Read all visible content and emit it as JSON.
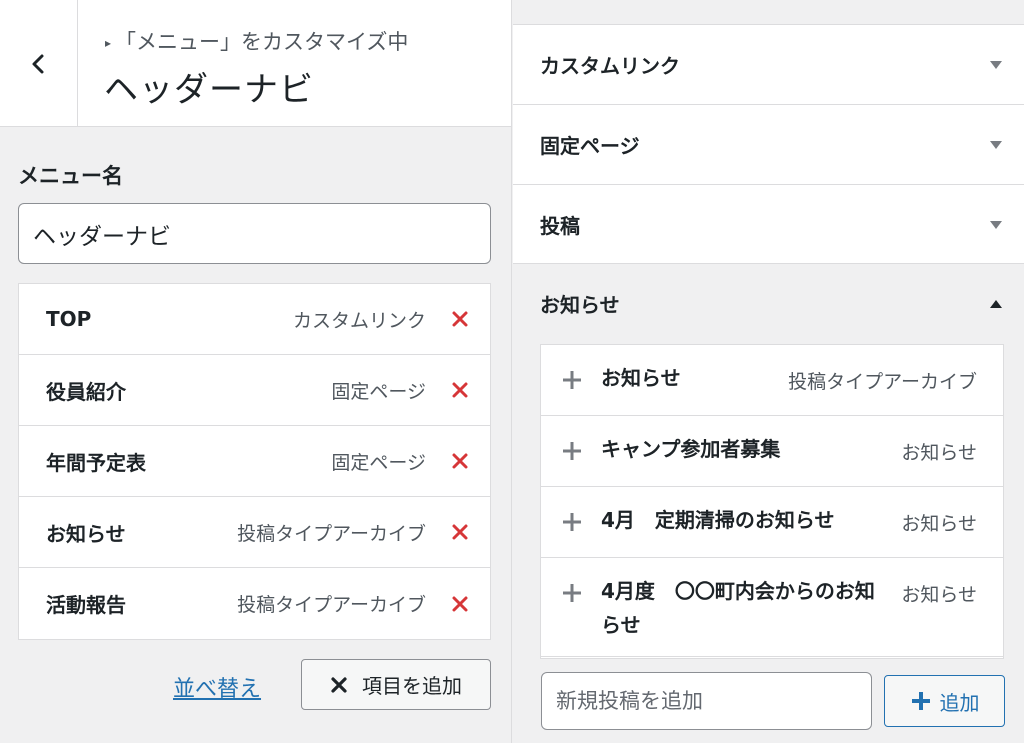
{
  "header": {
    "breadcrumb": "「メニュー」をカスタマイズ中",
    "title": "ヘッダーナビ"
  },
  "menu": {
    "name_label": "メニュー名",
    "name_value": "ヘッダーナビ",
    "items": [
      {
        "title": "TOP",
        "type": "カスタムリンク"
      },
      {
        "title": "役員紹介",
        "type": "固定ページ"
      },
      {
        "title": "年間予定表",
        "type": "固定ページ"
      },
      {
        "title": "お知らせ",
        "type": "投稿タイプアーカイブ"
      },
      {
        "title": "活動報告",
        "type": "投稿タイプアーカイブ"
      }
    ],
    "reorder_label": "並べ替え",
    "add_items_label": "項目を追加"
  },
  "sections": [
    {
      "title": "カスタムリンク"
    },
    {
      "title": "固定ページ"
    },
    {
      "title": "投稿"
    },
    {
      "title": "お知らせ"
    }
  ],
  "results": [
    {
      "title": "お知らせ",
      "type": "投稿タイプアーカイブ"
    },
    {
      "title": "キャンプ参加者募集",
      "type": "お知らせ"
    },
    {
      "title": "4月　定期清掃のお知らせ",
      "type": "お知らせ"
    },
    {
      "title": "4月度　〇〇町内会からのお知らせ",
      "type": "お知らせ"
    }
  ],
  "new_post": {
    "placeholder": "新規投稿を追加",
    "add_label": "追加"
  },
  "colors": {
    "remove": "#d63638",
    "link": "#2271b1",
    "arrow": "#787c82"
  }
}
